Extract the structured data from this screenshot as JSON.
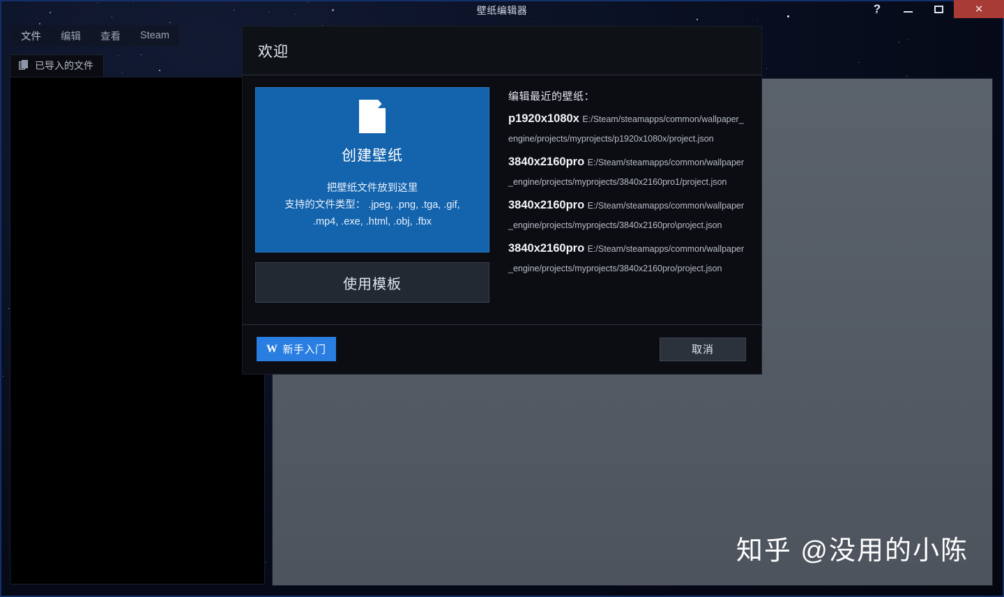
{
  "window": {
    "title": "壁纸编辑器",
    "controls": {
      "help": "?",
      "minimize": "minimize",
      "maximize": "maximize",
      "close": "✕"
    }
  },
  "menubar": {
    "items": [
      {
        "label": "文件"
      },
      {
        "label": "编辑"
      },
      {
        "label": "查看"
      },
      {
        "label": "Steam"
      }
    ]
  },
  "tabs": [
    {
      "label": "已导入的文件"
    }
  ],
  "viewport": {
    "watermark": "知乎 @没用的小陈"
  },
  "dialog": {
    "title": "欢迎",
    "create": {
      "title": "创建壁纸",
      "drop_hint": "把壁纸文件放到这里",
      "types_line1": "支持的文件类型： .jpeg, .png, .tga, .gif,",
      "types_line2": ".mp4, .exe, .html, .obj, .fbx"
    },
    "template_button": "使用模板",
    "recent": {
      "heading": "编辑最近的壁纸：",
      "items": [
        {
          "name": "p1920x1080x",
          "path": "E:/Steam/steamapps/common/wallpaper_engine/projects/myprojects/p1920x1080x/project.json"
        },
        {
          "name": "3840x2160pro",
          "path": "E:/Steam/steamapps/common/wallpaper_engine/projects/myprojects/3840x2160pro1/project.json"
        },
        {
          "name": "3840x2160pro",
          "path": "E:/Steam/steamapps/common/wallpaper_engine/projects/myprojects/3840x2160pro\\project.json"
        },
        {
          "name": "3840x2160pro",
          "path": "E:/Steam/steamapps/common/wallpaper_engine/projects/myprojects/3840x2160pro/project.json"
        }
      ]
    },
    "footer": {
      "tutorial_label": "新手入门",
      "tutorial_glyph": "W",
      "cancel_label": "取消"
    }
  },
  "colors": {
    "accent_blue": "#2a7de1",
    "create_card_blue": "#1363ad",
    "close_red": "#a83b36",
    "viewport_gray": "#565d66"
  }
}
